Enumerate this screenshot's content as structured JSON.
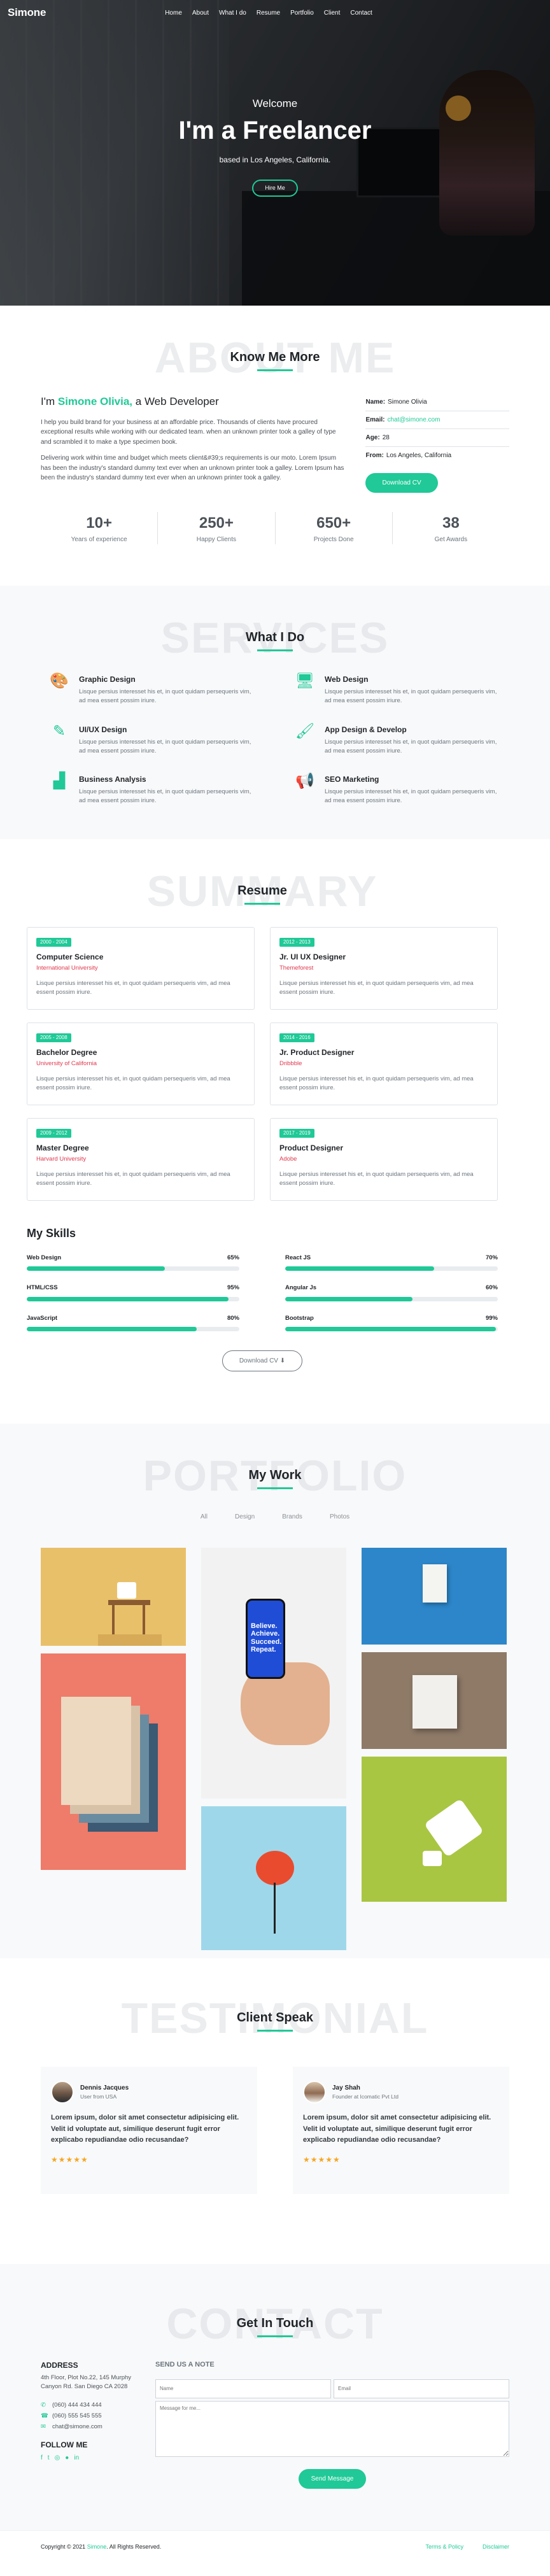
{
  "brand": "Simone",
  "nav": [
    "Home",
    "About",
    "What I do",
    "Resume",
    "Portfolio",
    "Client",
    "Contact"
  ],
  "hero": {
    "welcome": "Welcome",
    "title": "I'm a Freelancer",
    "subtitle": "based in Los Angeles, California.",
    "button": "Hire Me"
  },
  "about": {
    "bg_text": "ABOUT ME",
    "title": "Know Me More",
    "heading_prefix": "I'm",
    "name": "Simone Olivia,",
    "heading_suffix": "a Web Developer",
    "paragraph1": "I help you build brand for your business at an affordable price. Thousands of clients have procured exceptional results while working with our dedicated team. when an unknown printer took a galley of type and scrambled it to make a type specimen book.",
    "paragraph2": "Delivering work within time and budget which meets client&#39;s requirements is our moto. Lorem Ipsum has been the industry's standard dummy text ever when an unknown printer took a galley. Lorem Ipsum has been the industry's standard dummy text ever when an unknown printer took a galley.",
    "info": [
      {
        "label": "Name:",
        "value": "Simone Olivia"
      },
      {
        "label": "Email:",
        "value": "chat@simone.com"
      },
      {
        "label": "Age:",
        "value": "28"
      },
      {
        "label": "From:",
        "value": "Los Angeles, California"
      }
    ],
    "download_button": "Download CV",
    "stats": [
      {
        "number": "10+",
        "label": "Years of experience"
      },
      {
        "number": "250+",
        "label": "Happy Clients"
      },
      {
        "number": "650+",
        "label": "Projects Done"
      },
      {
        "number": "38",
        "label": "Get Awards"
      }
    ]
  },
  "services": {
    "bg_text": "SERVICES",
    "title": "What I Do",
    "items": [
      {
        "title": "Graphic Design",
        "desc": "Lisque persius interesset his et, in quot quidam persequeris vim, ad mea essent possim iriure.",
        "icon": "palette-icon"
      },
      {
        "title": "Web Design",
        "desc": "Lisque persius interesset his et, in quot quidam persequeris vim, ad mea essent possim iriure.",
        "icon": "desktop-icon"
      },
      {
        "title": "UI/UX Design",
        "desc": "Lisque persius interesset his et, in quot quidam persequeris vim, ad mea essent possim iriure.",
        "icon": "pencil-ruler-icon"
      },
      {
        "title": "App Design & Develop",
        "desc": "Lisque persius interesset his et, in quot quidam persequeris vim, ad mea essent possim iriure.",
        "icon": "paint-brush-icon"
      },
      {
        "title": "Business Analysis",
        "desc": "Lisque persius interesset his et, in quot quidam persequeris vim, ad mea essent possim iriure.",
        "icon": "chart-area-icon"
      },
      {
        "title": "SEO Marketing",
        "desc": "Lisque persius interesset his et, in quot quidam persequeris vim, ad mea essent possim iriure.",
        "icon": "bullhorn-icon"
      }
    ]
  },
  "resume": {
    "bg_text": "SUMMARY",
    "title": "Resume",
    "items": [
      {
        "years": "2000 - 2004",
        "title": "Computer Science",
        "place": "International University",
        "desc": "Lisque persius interesset his et, in quot quidam persequeris vim, ad mea essent possim iriure."
      },
      {
        "years": "2012 - 2013",
        "title": "Jr. UI UX Designer",
        "place": "Themeforest",
        "desc": "Lisque persius interesset his et, in quot quidam persequeris vim, ad mea essent possim iriure."
      },
      {
        "years": "2005 - 2008",
        "title": "Bachelor Degree",
        "place": "University of California",
        "desc": "Lisque persius interesset his et, in quot quidam persequeris vim, ad mea essent possim iriure."
      },
      {
        "years": "2014 - 2016",
        "title": "Jr. Product Designer",
        "place": "Dribbble",
        "desc": "Lisque persius interesset his et, in quot quidam persequeris vim, ad mea essent possim iriure."
      },
      {
        "years": "2009 - 2012",
        "title": "Master Degree",
        "place": "Harvard University",
        "desc": "Lisque persius interesset his et, in quot quidam persequeris vim, ad mea essent possim iriure."
      },
      {
        "years": "2017 - 2019",
        "title": "Product Designer",
        "place": "Adobe",
        "desc": "Lisque persius interesset his et, in quot quidam persequeris vim, ad mea essent possim iriure."
      }
    ],
    "skills_title": "My Skills",
    "skills": [
      {
        "name": "Web Design",
        "pct": "65%",
        "value": 65
      },
      {
        "name": "React JS",
        "pct": "70%",
        "value": 70
      },
      {
        "name": "HTML/CSS",
        "pct": "95%",
        "value": 95
      },
      {
        "name": "Angular Js",
        "pct": "60%",
        "value": 60
      },
      {
        "name": "JavaScript",
        "pct": "80%",
        "value": 80
      },
      {
        "name": "Bootstrap",
        "pct": "99%",
        "value": 99
      }
    ],
    "download_button": "Download CV"
  },
  "portfolio": {
    "bg_text": "PORTFOLIO",
    "title": "My Work",
    "filters": [
      "All",
      "Design",
      "Brands",
      "Photos"
    ],
    "phone_text": "Believe. Achieve. Succeed. Repeat."
  },
  "testimonial": {
    "bg_text": "TESTIMONIAL",
    "title": "Client Speak",
    "items": [
      {
        "name": "Dennis Jacques",
        "role": "User from USA",
        "quote": "Lorem ipsum, dolor sit amet consectetur adipisicing elit. Velit id voluptate aut, similique deserunt fugit error explicabo repudiandae odio recusandae?",
        "stars": "★★★★★"
      },
      {
        "name": "Jay Shah",
        "role": "Founder at Icomatic Pvt Ltd",
        "quote": "Lorem ipsum, dolor sit amet consectetur adipisicing elit. Velit id voluptate aut, similique deserunt fugit error explicabo repudiandae odio recusandae?",
        "stars": "★★★★★"
      }
    ]
  },
  "contact": {
    "bg_text": "CONTACT",
    "title": "Get In Touch",
    "address_label": "ADDRESS",
    "address": "4th Floor, Plot No.22, 145 Murphy Canyon Rd. San Diego CA 2028",
    "phone1": "(060) 444 434 444",
    "phone2": "(060) 555 545 555",
    "email": "chat@simone.com",
    "follow_label": "FOLLOW ME",
    "form_title": "SEND US A NOTE",
    "name_placeholder": "Name",
    "email_placeholder": "Email",
    "message_placeholder": "Message for me...",
    "send_button": "Send Message"
  },
  "footer": {
    "copyright_prefix": "Copyright © 2021",
    "copyright_brand": "Simone",
    "copyright_suffix": ". All Rights Reserved.",
    "links": [
      "Terms & Policy",
      "Disclaimer"
    ]
  },
  "colors": {
    "accent": "#20c997",
    "red": "#e0374c"
  }
}
